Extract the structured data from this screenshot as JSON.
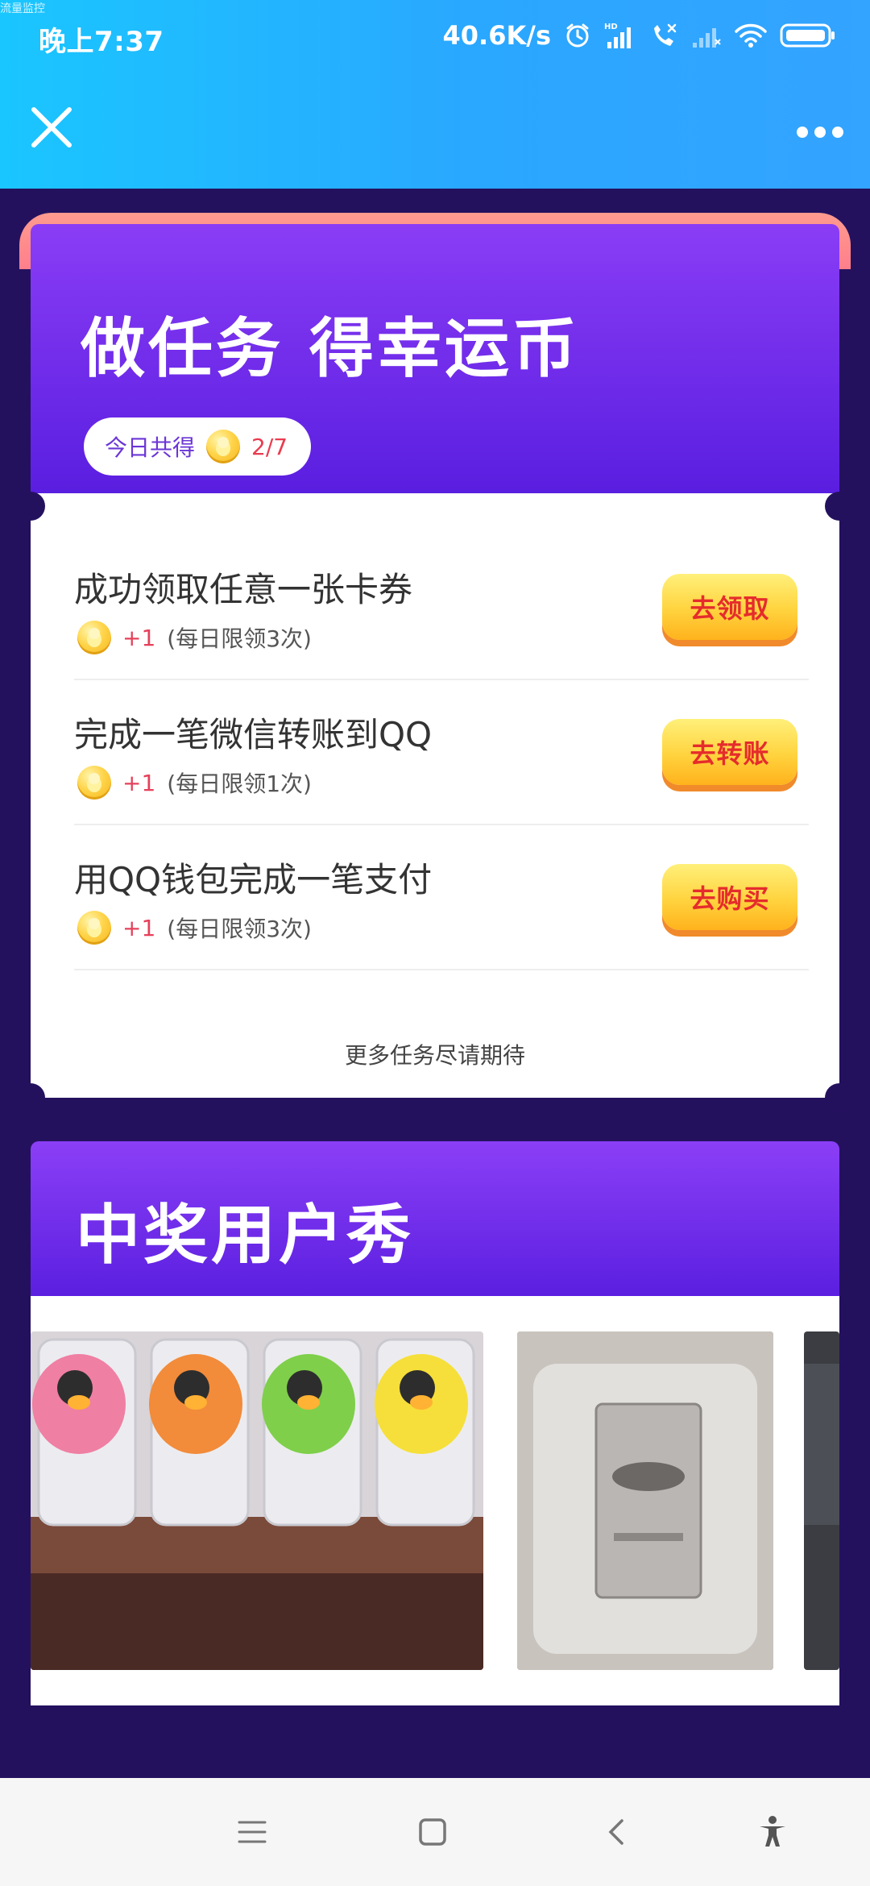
{
  "status_bar": {
    "top_label": "流量监控",
    "time": "晚上7:37",
    "net_speed": "40.6K/s",
    "icons": [
      "alarm-icon",
      "hd-signal-icon",
      "call-muted-icon",
      "signal-bars-icon",
      "wifi-icon",
      "battery-icon"
    ]
  },
  "header": {
    "close_icon": "close-icon",
    "more_icon": "more-options-icon"
  },
  "task_card": {
    "title": "做任务 得幸运币",
    "today_label": "今日共得",
    "today_count": "2/7",
    "tasks": [
      {
        "name": "成功领取任意一张卡券",
        "reward": "+1",
        "limit": "(每日限领3次)",
        "button": "去领取"
      },
      {
        "name": "完成一笔微信转账到QQ",
        "reward": "+1",
        "limit": "(每日限领1次)",
        "button": "去转账"
      },
      {
        "name": "用QQ钱包完成一笔支付",
        "reward": "+1",
        "limit": "(每日限领3次)",
        "button": "去购买"
      }
    ],
    "more_text": "更多任务尽请期待"
  },
  "winner_card": {
    "title": "中奖用户秀"
  },
  "colors": {
    "status_gradient": "#1ac6ff",
    "page_bg": "#24115e",
    "header_purple": "#8a3df5",
    "button_yellow": "#ffd33e",
    "button_text": "#e52c2c",
    "reward_red": "#e6405a"
  },
  "nav": {
    "icons": [
      "menu-icon",
      "home-icon",
      "back-icon",
      "accessibility-icon"
    ]
  }
}
